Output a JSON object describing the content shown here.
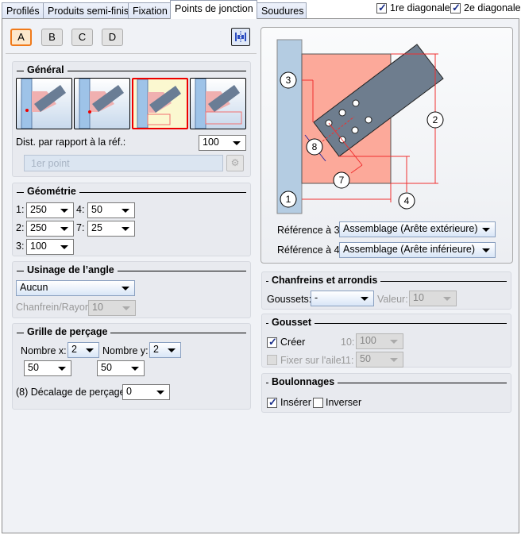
{
  "tabs": [
    {
      "label": "Profilés"
    },
    {
      "label": "Produits semi-finis"
    },
    {
      "label": "Fixation"
    },
    {
      "label": "Points de jonction",
      "active": true
    },
    {
      "label": "Soudures"
    }
  ],
  "header": {
    "diag1_label": "1re diagonale",
    "diag1_checked": true,
    "diag2_label": "2e diagonale",
    "diag2_checked": true
  },
  "variants": [
    "A",
    "B",
    "C",
    "D"
  ],
  "selected_variant": "A",
  "accent": "#f07a1a",
  "general": {
    "title": "Général",
    "selected_option": 3,
    "dist_label": "Dist. par rapport à la réf.:",
    "dist_value": "100",
    "point_placeholder": "1er point"
  },
  "geometry": {
    "title": "Géométrie",
    "fields": [
      {
        "label": "1:",
        "value": "250"
      },
      {
        "label": "4:",
        "value": "50"
      },
      {
        "label": "2:",
        "value": "250"
      },
      {
        "label": "7:",
        "value": "25"
      },
      {
        "label": "3:",
        "value": "100"
      }
    ]
  },
  "angle": {
    "title": "Usinage de l’angle",
    "type_value": "Aucun",
    "chamfer_label": "Chanfrein/Rayon:",
    "chamfer_value": "10"
  },
  "grid": {
    "title": "Grille de perçage",
    "nx_label": "Nombre x:",
    "nx_value": "2",
    "ny_label": "Nombre y:",
    "ny_value": "2",
    "dx_value": "50",
    "dy_value": "50",
    "offset_label": "(8) Décalage de perçage:",
    "offset_value": "0"
  },
  "diagram": {
    "labels": [
      "3",
      "2",
      "8",
      "7",
      "1",
      "4"
    ]
  },
  "refs": {
    "ref3_label": "Référence à 3:",
    "ref3_value": "Assemblage (Arête extérieure)",
    "ref4_label": "Référence à 4:",
    "ref4_value": "Assemblage (Arête inférieure)"
  },
  "chamfers": {
    "title": "Chanfreins et arrondis",
    "gussets_label": "Goussets:",
    "gussets_value": "-",
    "value_label": "Valeur:",
    "value_value": "10"
  },
  "gusset": {
    "title": "Gousset",
    "create_label": "Créer",
    "create_checked": true,
    "flange_label": "Fixer sur l'aile",
    "flange_checked": false,
    "f10_label": "10:",
    "f10_value": "100",
    "f11_label": "11:",
    "f11_value": "50"
  },
  "bolts": {
    "title": "Boulonnages",
    "insert_label": "Insérer",
    "insert_checked": true,
    "invert_label": "Inverser",
    "invert_checked": false
  }
}
